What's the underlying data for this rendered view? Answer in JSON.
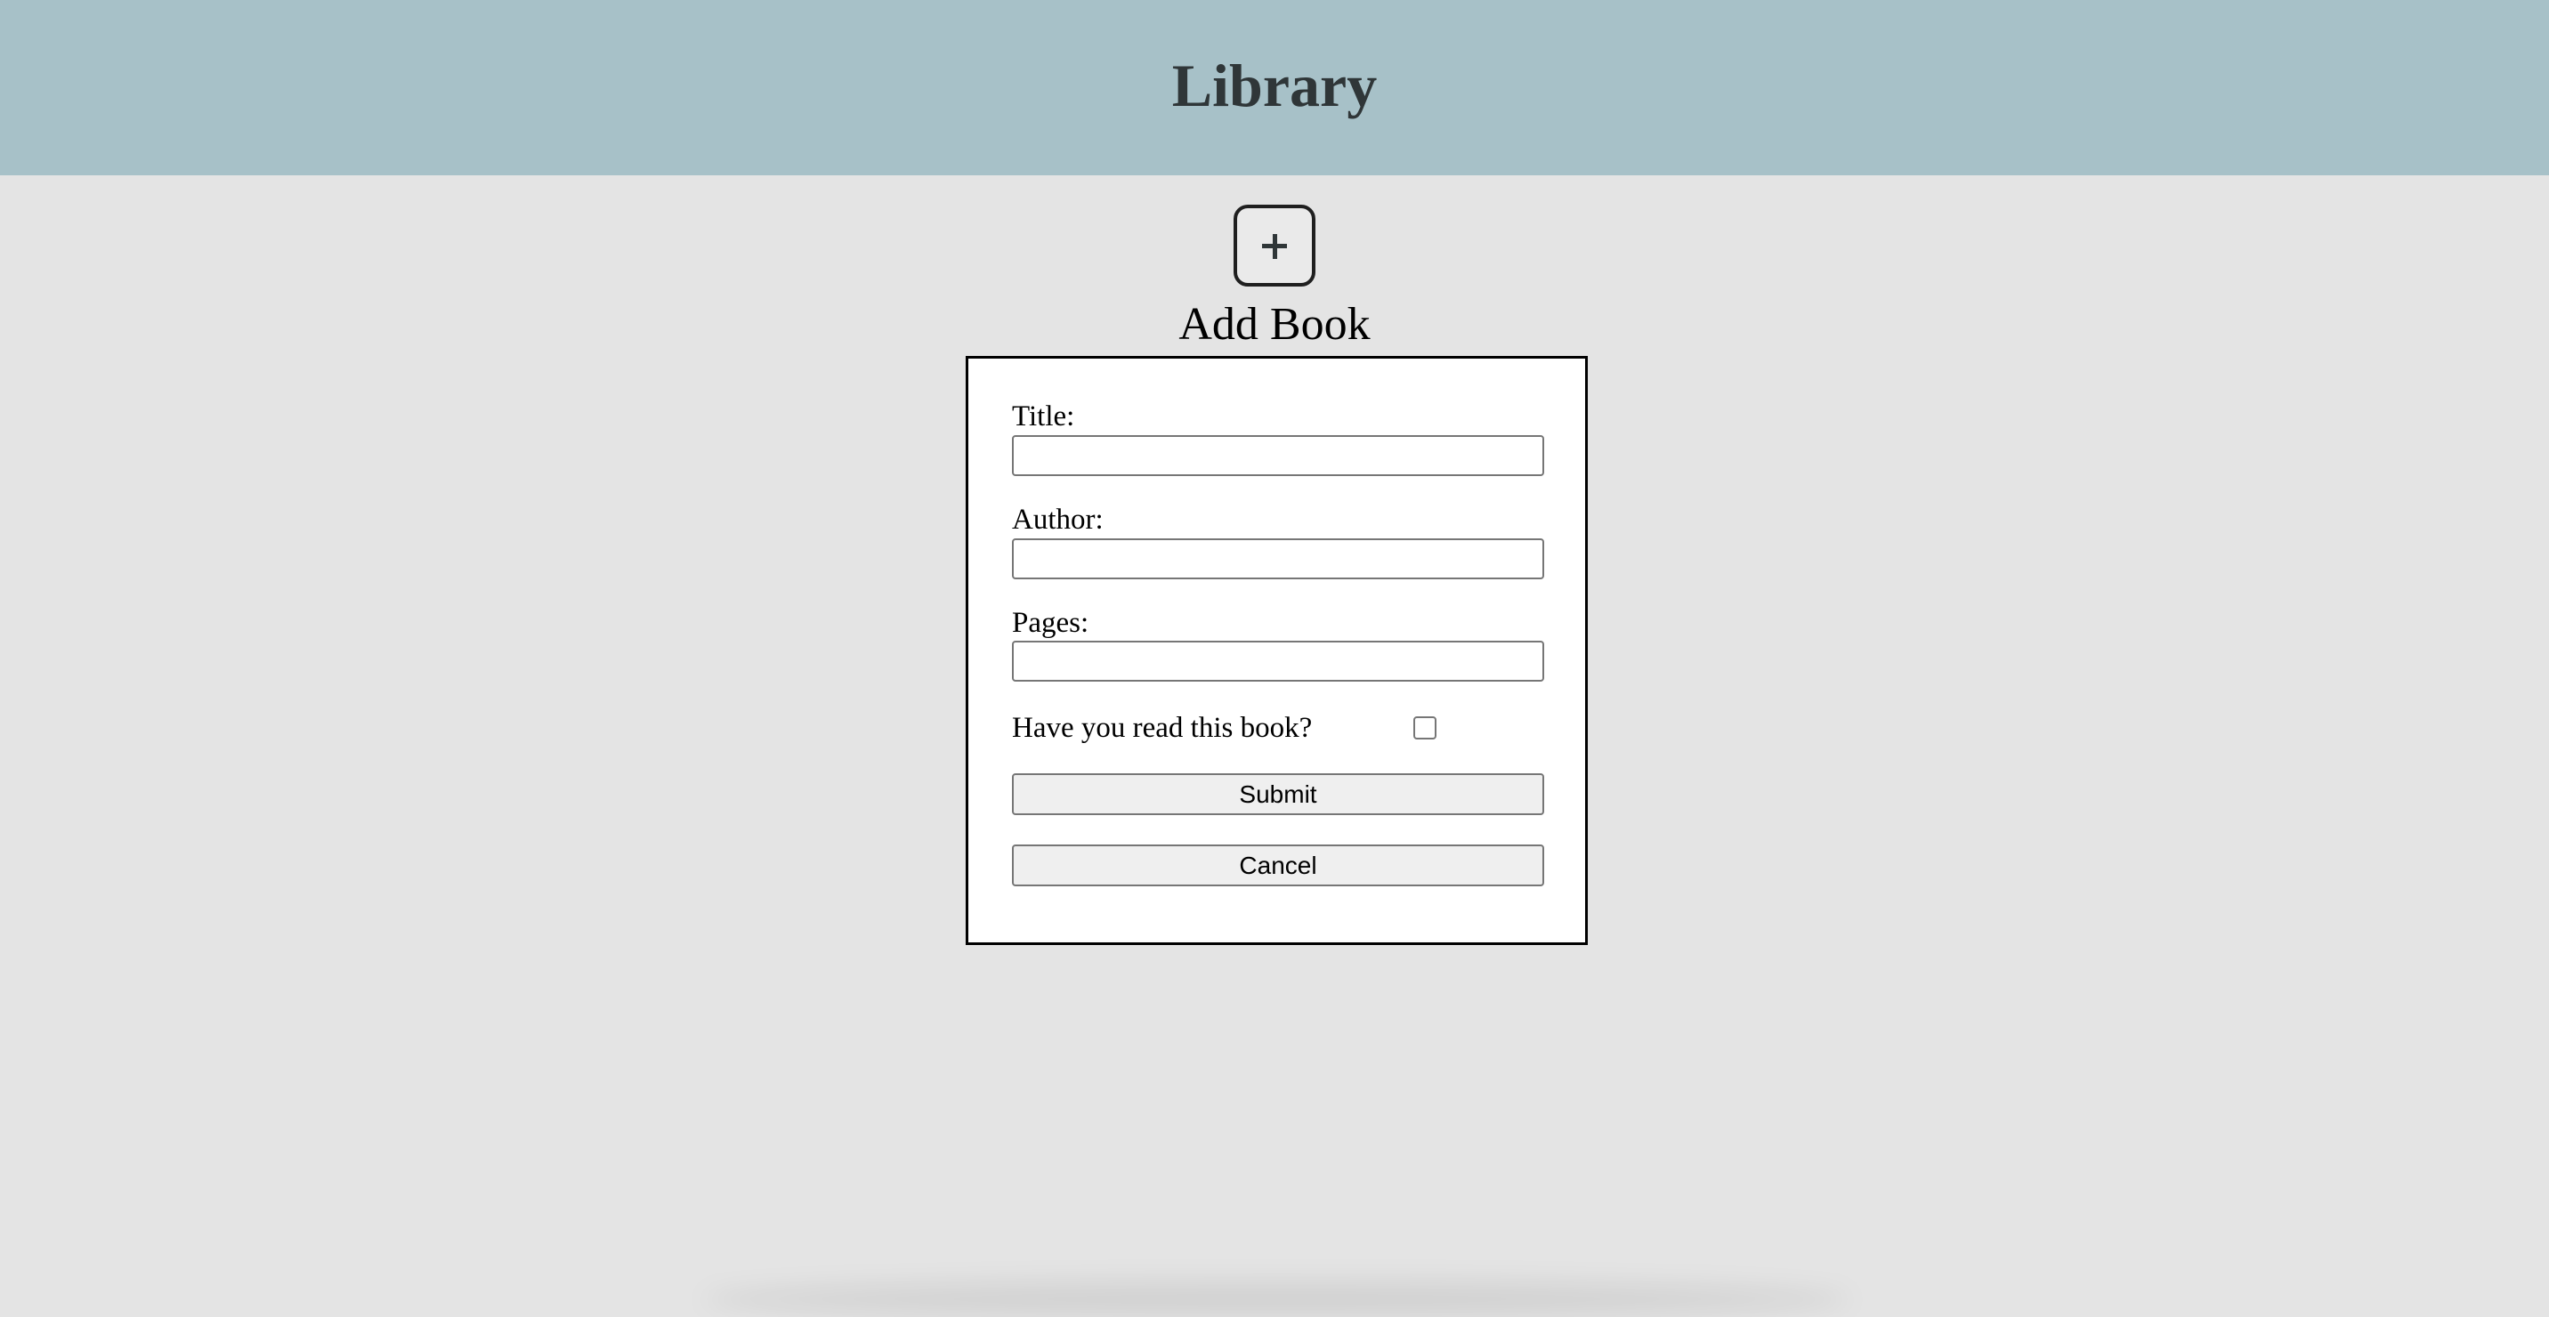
{
  "header": {
    "title": "Library"
  },
  "add_book": {
    "button_icon": "plus-icon",
    "label": "Add Book"
  },
  "form": {
    "title_label": "Title:",
    "title_value": "",
    "author_label": "Author:",
    "author_value": "",
    "pages_label": "Pages:",
    "pages_value": "",
    "read_question": "Have you read this book?",
    "read_checked": false,
    "submit_label": "Submit",
    "cancel_label": "Cancel"
  },
  "colors": {
    "header_bg": "#a7c1c8",
    "page_bg": "#e4e4e4",
    "title_text": "#2f3638"
  }
}
